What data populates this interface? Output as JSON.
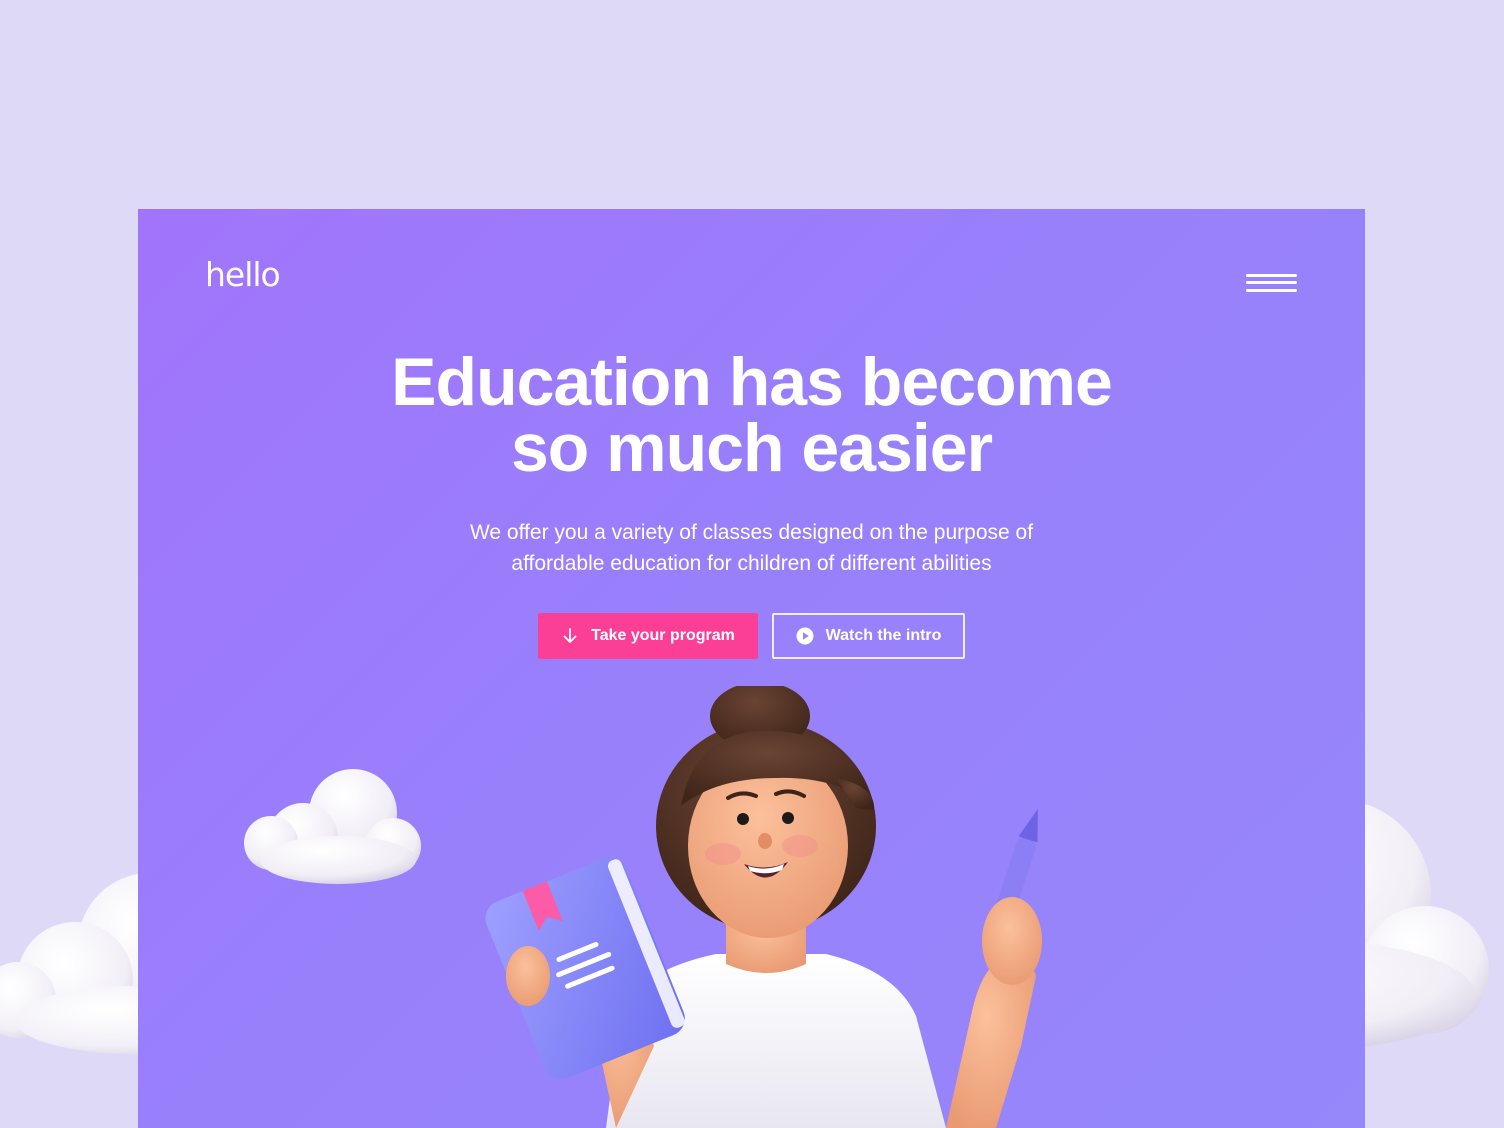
{
  "brand": {
    "logo_text": "hello"
  },
  "nav": {
    "menu_icon": "hamburger-menu-icon"
  },
  "hero": {
    "headline_line1": "Education has become",
    "headline_line2": "so much easier",
    "subtext_line1": "We offer you a variety of classes designed on the purpose of",
    "subtext_line2": "affordable education for children of different abilities",
    "primary_button": {
      "label": "Take your program",
      "icon": "arrow-down-icon"
    },
    "secondary_button": {
      "label": "Watch the intro",
      "icon": "play-circle-icon"
    }
  },
  "colors": {
    "page_background": "#dfd9f8",
    "hero_gradient_start": "#a174fb",
    "hero_gradient_end": "#9687fb",
    "primary_button": "#fb3f97",
    "text": "#ffffff"
  }
}
